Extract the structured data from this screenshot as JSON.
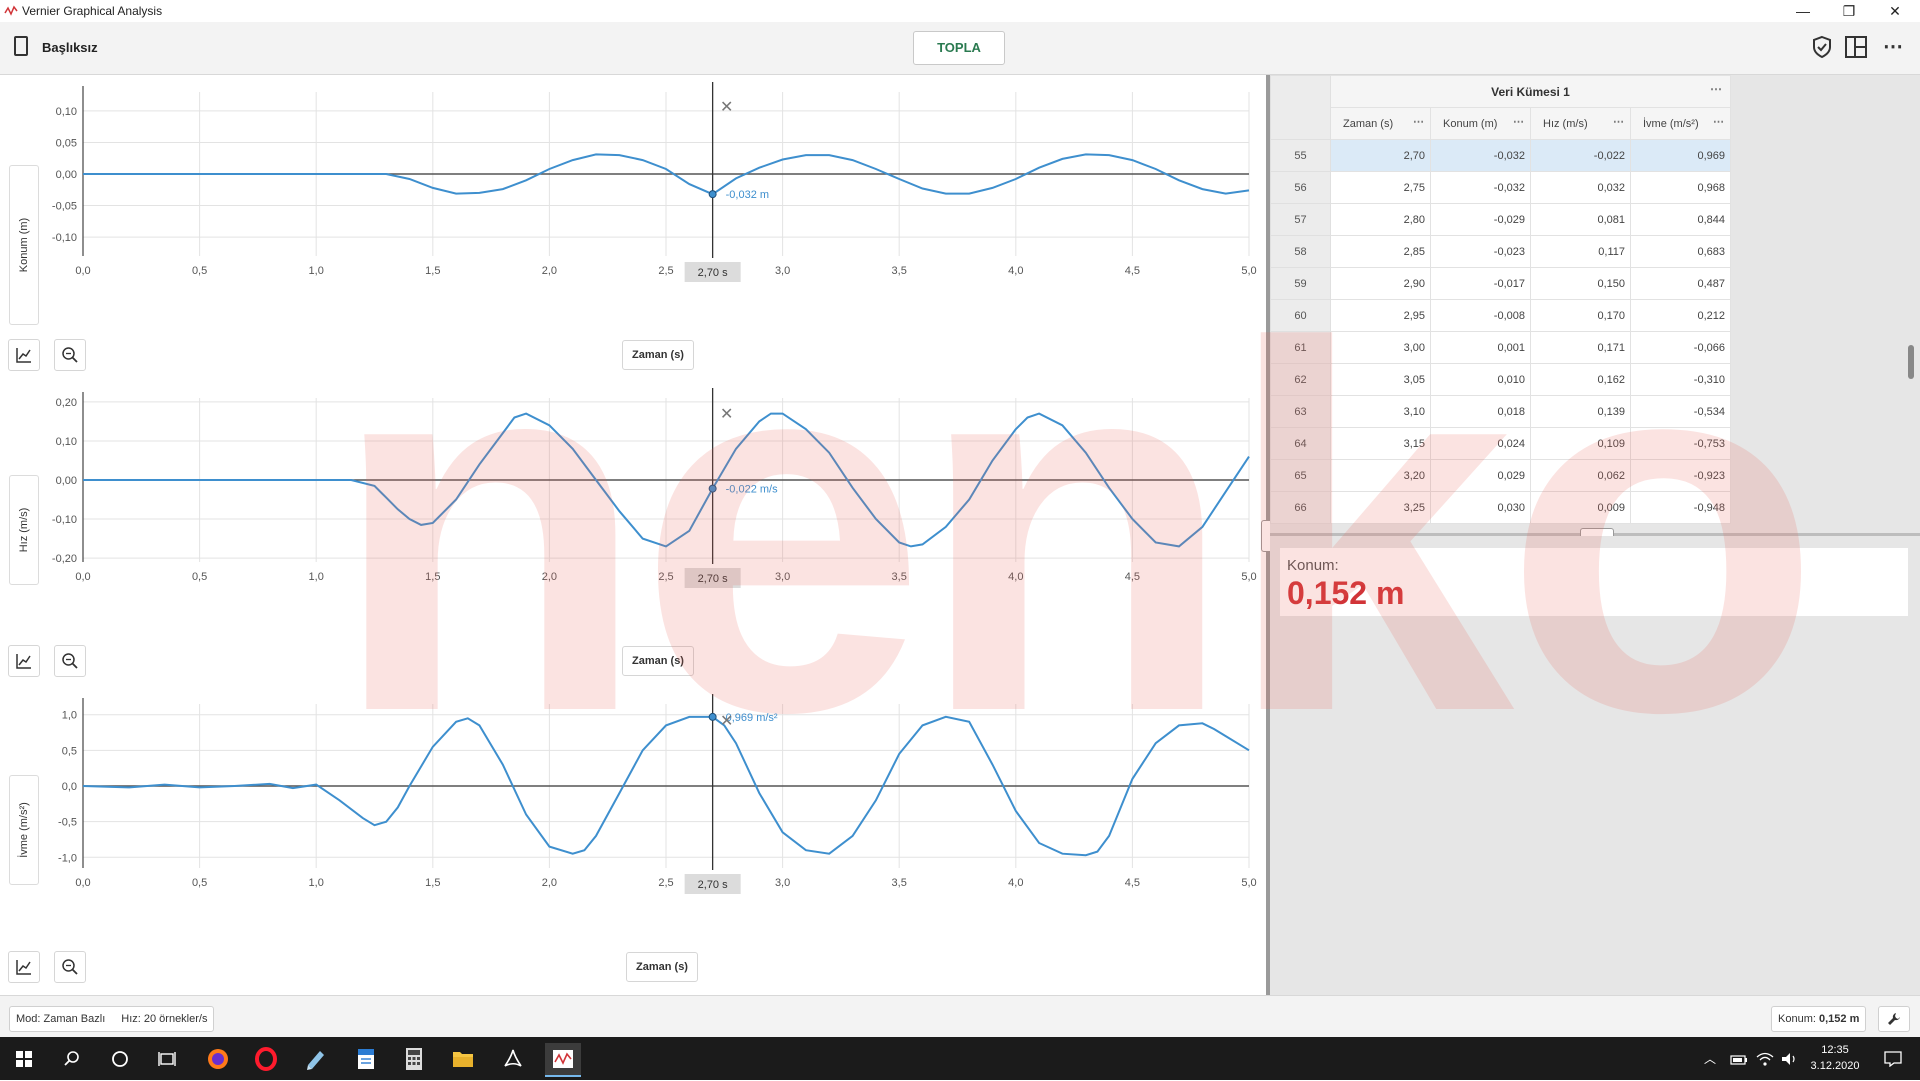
{
  "window": {
    "title": "Vernier Graphical Analysis"
  },
  "toolbar": {
    "doc_name": "Başlıksız",
    "collect_label": "TOPLA"
  },
  "graphs": [
    {
      "id": "konum",
      "ylabel": "Konum (m)",
      "ylim": [
        -0.13,
        0.13
      ],
      "yticks": [
        0.1,
        0.05,
        0.0,
        -0.05,
        -0.1
      ],
      "ytick_labels": [
        "0,10",
        "0,05",
        "0,00",
        "-0,05",
        "-0,10"
      ],
      "xlabel": "Zaman (s)",
      "cursor_value": "-0,032 m",
      "cursor_y": -0.032,
      "cursor_x_label": "2,70 s"
    },
    {
      "id": "hiz",
      "ylabel": "Hız (m/s)",
      "ylim": [
        -0.21,
        0.21
      ],
      "yticks": [
        0.2,
        0.1,
        0.0,
        -0.1,
        -0.2
      ],
      "ytick_labels": [
        "0,20",
        "0,10",
        "0,00",
        "-0,10",
        "-0,20"
      ],
      "xlabel": "Zaman (s)",
      "cursor_value": "-0,022 m/s",
      "cursor_y": -0.022,
      "cursor_x_label": "2,70 s"
    },
    {
      "id": "ivme",
      "ylabel": "İvme (m/s²)",
      "ylim": [
        -1.15,
        1.15
      ],
      "yticks": [
        1.0,
        0.5,
        0.0,
        -0.5,
        -1.0
      ],
      "ytick_labels": [
        "1,0",
        "0,5",
        "0,0",
        "-0,5",
        "-1,0"
      ],
      "xlabel": "Zaman (s)",
      "cursor_value": "0,969 m/s²",
      "cursor_y": 0.969,
      "cursor_x_label": "2,70 s"
    }
  ],
  "chart_data": [
    {
      "type": "line",
      "title": "",
      "xlabel": "Zaman (s)",
      "ylabel": "Konum (m)",
      "xlim": [
        0,
        5
      ],
      "ylim": [
        -0.13,
        0.13
      ],
      "grid": true,
      "x": [
        0,
        0.25,
        0.5,
        0.75,
        1.0,
        1.2,
        1.3,
        1.4,
        1.5,
        1.6,
        1.7,
        1.8,
        1.9,
        2.0,
        2.1,
        2.2,
        2.3,
        2.4,
        2.5,
        2.6,
        2.7,
        2.8,
        2.9,
        3.0,
        3.1,
        3.2,
        3.3,
        3.4,
        3.5,
        3.6,
        3.7,
        3.8,
        3.9,
        4.0,
        4.1,
        4.2,
        4.3,
        4.4,
        4.5,
        4.6,
        4.7,
        4.8,
        4.9,
        5.0
      ],
      "series": [
        {
          "values": [
            0,
            0,
            0,
            0,
            0,
            0,
            0,
            -0.008,
            -0.022,
            -0.031,
            -0.03,
            -0.024,
            -0.01,
            0.008,
            0.022,
            0.031,
            0.03,
            0.022,
            0.008,
            -0.016,
            -0.032,
            -0.007,
            0.01,
            0.023,
            0.03,
            0.03,
            0.022,
            0.008,
            -0.008,
            -0.023,
            -0.031,
            -0.031,
            -0.022,
            -0.008,
            0.01,
            0.024,
            0.031,
            0.03,
            0.022,
            0.008,
            -0.01,
            -0.024,
            -0.031,
            -0.026
          ]
        }
      ],
      "x_ticks": [
        "0,0",
        "0,5",
        "1,0",
        "1,5",
        "2,0",
        "2,5",
        "3,0",
        "3,5",
        "4,0",
        "4,5",
        "5,0"
      ]
    },
    {
      "type": "line",
      "title": "",
      "xlabel": "Zaman (s)",
      "ylabel": "Hız (m/s)",
      "xlim": [
        0,
        5
      ],
      "ylim": [
        -0.21,
        0.21
      ],
      "grid": true,
      "x": [
        0,
        0.25,
        0.5,
        0.75,
        1.0,
        1.15,
        1.25,
        1.3,
        1.35,
        1.4,
        1.45,
        1.5,
        1.6,
        1.7,
        1.8,
        1.85,
        1.9,
        2.0,
        2.1,
        2.2,
        2.3,
        2.4,
        2.5,
        2.6,
        2.7,
        2.8,
        2.9,
        2.95,
        3.0,
        3.1,
        3.2,
        3.3,
        3.4,
        3.5,
        3.55,
        3.6,
        3.7,
        3.8,
        3.9,
        4.0,
        4.05,
        4.1,
        4.2,
        4.3,
        4.4,
        4.5,
        4.6,
        4.7,
        4.8,
        4.9,
        5.0
      ],
      "series": [
        {
          "values": [
            0,
            0,
            0,
            0,
            0,
            0,
            -0.015,
            -0.045,
            -0.075,
            -0.1,
            -0.115,
            -0.11,
            -0.05,
            0.04,
            0.12,
            0.16,
            0.17,
            0.14,
            0.08,
            0,
            -0.08,
            -0.15,
            -0.17,
            -0.13,
            -0.022,
            0.08,
            0.15,
            0.17,
            0.17,
            0.13,
            0.07,
            -0.02,
            -0.1,
            -0.16,
            -0.17,
            -0.165,
            -0.12,
            -0.05,
            0.05,
            0.13,
            0.16,
            0.17,
            0.14,
            0.07,
            -0.02,
            -0.1,
            -0.16,
            -0.17,
            -0.12,
            -0.03,
            0.06
          ]
        }
      ],
      "x_ticks": [
        "0,0",
        "0,5",
        "1,0",
        "1,5",
        "2,0",
        "2,5",
        "3,0",
        "3,5",
        "4,0",
        "4,5",
        "5,0"
      ]
    },
    {
      "type": "line",
      "title": "",
      "xlabel": "Zaman (s)",
      "ylabel": "İvme (m/s²)",
      "xlim": [
        0,
        5
      ],
      "ylim": [
        -1.15,
        1.15
      ],
      "grid": true,
      "x": [
        0,
        0.2,
        0.35,
        0.5,
        0.65,
        0.8,
        0.9,
        1.0,
        1.1,
        1.2,
        1.25,
        1.3,
        1.35,
        1.4,
        1.5,
        1.6,
        1.65,
        1.7,
        1.8,
        1.9,
        2.0,
        2.1,
        2.15,
        2.2,
        2.3,
        2.4,
        2.5,
        2.6,
        2.7,
        2.75,
        2.8,
        2.9,
        3.0,
        3.1,
        3.2,
        3.3,
        3.4,
        3.5,
        3.6,
        3.7,
        3.8,
        3.9,
        4.0,
        4.1,
        4.2,
        4.3,
        4.35,
        4.4,
        4.5,
        4.6,
        4.7,
        4.8,
        4.85,
        4.9,
        5.0
      ],
      "series": [
        {
          "values": [
            0,
            -0.02,
            0.02,
            -0.02,
            0.0,
            0.03,
            -0.03,
            0.02,
            -0.2,
            -0.45,
            -0.55,
            -0.5,
            -0.3,
            0.0,
            0.55,
            0.9,
            0.95,
            0.85,
            0.3,
            -0.4,
            -0.85,
            -0.95,
            -0.9,
            -0.7,
            -0.1,
            0.5,
            0.85,
            0.969,
            0.969,
            0.85,
            0.6,
            -0.1,
            -0.65,
            -0.9,
            -0.95,
            -0.7,
            -0.2,
            0.45,
            0.85,
            0.97,
            0.9,
            0.3,
            -0.35,
            -0.8,
            -0.95,
            -0.97,
            -0.92,
            -0.7,
            0.1,
            0.6,
            0.85,
            0.88,
            0.8,
            0.7,
            0.5
          ]
        }
      ],
      "x_ticks": [
        "0,0",
        "0,5",
        "1,0",
        "1,5",
        "2,0",
        "2,5",
        "3,0",
        "3,5",
        "4,0",
        "4,5",
        "5,0"
      ]
    }
  ],
  "cursor": {
    "x": 2.7
  },
  "table": {
    "dataset_title": "Veri Kümesi 1",
    "columns": [
      "Zaman (s)",
      "Konum (m)",
      "Hız (m/s)",
      "İvme (m/s²)"
    ],
    "rows": [
      {
        "n": "55",
        "cells": [
          "2,70",
          "-0,032",
          "-0,022",
          "0,969"
        ],
        "selected": true
      },
      {
        "n": "56",
        "cells": [
          "2,75",
          "-0,032",
          "0,032",
          "0,968"
        ]
      },
      {
        "n": "57",
        "cells": [
          "2,80",
          "-0,029",
          "0,081",
          "0,844"
        ]
      },
      {
        "n": "58",
        "cells": [
          "2,85",
          "-0,023",
          "0,117",
          "0,683"
        ]
      },
      {
        "n": "59",
        "cells": [
          "2,90",
          "-0,017",
          "0,150",
          "0,487"
        ]
      },
      {
        "n": "60",
        "cells": [
          "2,95",
          "-0,008",
          "0,170",
          "0,212"
        ]
      },
      {
        "n": "61",
        "cells": [
          "3,00",
          "0,001",
          "0,171",
          "-0,066"
        ]
      },
      {
        "n": "62",
        "cells": [
          "3,05",
          "0,010",
          "0,162",
          "-0,310"
        ]
      },
      {
        "n": "63",
        "cells": [
          "3,10",
          "0,018",
          "0,139",
          "-0,534"
        ]
      },
      {
        "n": "64",
        "cells": [
          "3,15",
          "0,024",
          "0,109",
          "-0,753"
        ]
      },
      {
        "n": "65",
        "cells": [
          "3,20",
          "0,029",
          "0,062",
          "-0,923"
        ]
      },
      {
        "n": "66",
        "cells": [
          "3,25",
          "0,030",
          "0,009",
          "-0,948"
        ]
      }
    ]
  },
  "meter": {
    "label": "Konum:",
    "value": "0,152 m"
  },
  "status": {
    "mode": "Mod: Zaman Bazlı",
    "rate": "Hız: 20 örnekler/s",
    "meter_label": "Konum:",
    "meter_value": "0,152 m"
  },
  "taskbar": {
    "time": "12:35",
    "date": "3.12.2020"
  },
  "watermark": "nenko",
  "colors": {
    "series": "#3e8fce",
    "accent": "#d13438",
    "selected_row": "#dbeaf7",
    "collect": "#2a7a50"
  }
}
